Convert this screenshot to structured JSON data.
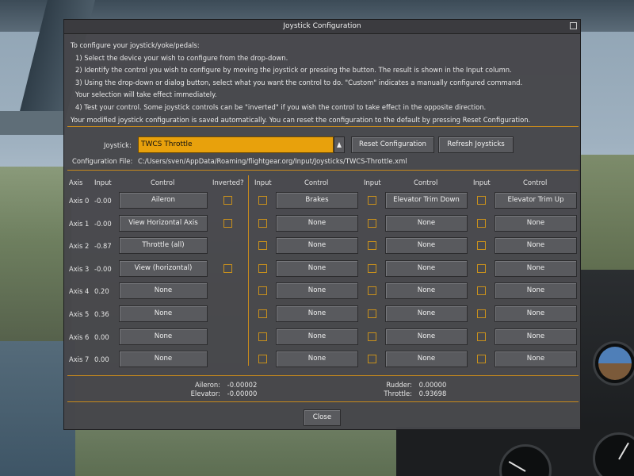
{
  "dialog": {
    "title": "Joystick Configuration",
    "instructions": [
      "To configure your joystick/yoke/pedals:",
      "1) Select the device your wish to configure from the drop-down.",
      "2) Identify the control you wish to configure by moving the joystick or pressing the button.  The result is shown in the Input column.",
      "3) Using the drop-down or dialog button, select what you want the control to do.  \"Custom\" indicates a manually configured command.",
      "Your selection will take effect immediately.",
      "4) Test your control.  Some joystick controls can be \"inverted\" if you wish the control to take effect in the opposite direction.",
      "Your modified joystick configuration is saved automatically.  You can reset the configuration to the default by pressing Reset Configuration."
    ],
    "joystick_label": "Joystick:",
    "joystick_value": "TWCS Throttle",
    "reset_button": "Reset Configuration",
    "refresh_button": "Refresh Joysticks",
    "config_file_label": "Configuration File:",
    "config_file_path": "C:/Users/sven/AppData/Roaming/flightgear.org/Input/Joysticks/TWCS-Throttle.xml",
    "close_button": "Close"
  },
  "axes_headers": {
    "axis": "Axis",
    "input": "Input",
    "control": "Control",
    "inverted": "Inverted?",
    "btn_input": "Input",
    "btn_control": "Control"
  },
  "axes": [
    {
      "name": "Axis 0",
      "input": "-0.00",
      "control": "Aileron",
      "has_inverted": true,
      "buttons": [
        "Brakes",
        "Elevator Trim Down",
        "Elevator Trim Up"
      ]
    },
    {
      "name": "Axis 1",
      "input": "-0.00",
      "control": "View Horizontal Axis",
      "has_inverted": true,
      "buttons": [
        "None",
        "None",
        "None"
      ]
    },
    {
      "name": "Axis 2",
      "input": "-0.87",
      "control": "Throttle (all)",
      "has_inverted": false,
      "buttons": [
        "None",
        "None",
        "None"
      ]
    },
    {
      "name": "Axis 3",
      "input": "-0.00",
      "control": "View (horizontal)",
      "has_inverted": true,
      "buttons": [
        "None",
        "None",
        "None"
      ]
    },
    {
      "name": "Axis 4",
      "input": "0.20",
      "control": "None",
      "has_inverted": false,
      "buttons": [
        "None",
        "None",
        "None"
      ]
    },
    {
      "name": "Axis 5",
      "input": "0.36",
      "control": "None",
      "has_inverted": false,
      "buttons": [
        "None",
        "None",
        "None"
      ]
    },
    {
      "name": "Axis 6",
      "input": "0.00",
      "control": "None",
      "has_inverted": false,
      "buttons": [
        "None",
        "None",
        "None"
      ]
    },
    {
      "name": "Axis 7",
      "input": "0.00",
      "control": "None",
      "has_inverted": false,
      "buttons": [
        "None",
        "None",
        "None"
      ]
    }
  ],
  "status": {
    "aileron_label": "Aileron:",
    "aileron_value": "-0.00002",
    "elevator_label": "Elevator:",
    "elevator_value": "-0.00000",
    "rudder_label": "Rudder:",
    "rudder_value": "0.00000",
    "throttle_label": "Throttle:",
    "throttle_value": "0.93698"
  },
  "colors": {
    "accent": "#c88a1c",
    "combo_bg": "#e8a10c",
    "dialog_bg": "#46464a"
  }
}
